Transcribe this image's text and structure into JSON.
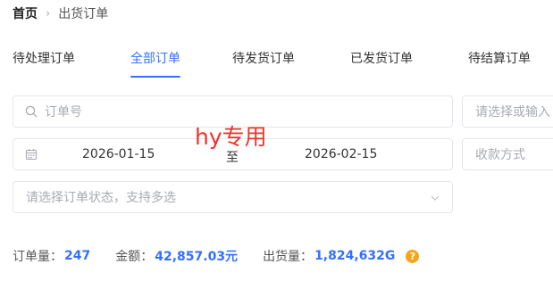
{
  "breadcrumb": {
    "home": "首页",
    "separator": "›",
    "current": "出货订单"
  },
  "tabs": [
    {
      "label": "待处理订单",
      "active": false
    },
    {
      "label": "全部订单",
      "active": true
    },
    {
      "label": "待发货订单",
      "active": false
    },
    {
      "label": "已发货订单",
      "active": false
    },
    {
      "label": "待结算订单",
      "active": false
    }
  ],
  "filters": {
    "order_no_placeholder": "订单号",
    "select_placeholder": "请选择或输入",
    "date_start": "2026-01-15",
    "date_separator": "至",
    "date_end": "2026-02-15",
    "payment_placeholder": "收款方式",
    "status_placeholder": "请选择订单状态，支持多选"
  },
  "watermark": "hy专用",
  "summary": {
    "order_count_label": "订单量：",
    "order_count": "247",
    "amount_label": "金额：",
    "amount": "42,857.03元",
    "shipment_label": "出货量：",
    "shipment": "1,824,632G",
    "help_icon_text": "?"
  },
  "colors": {
    "accent": "#3370ff",
    "watermark": "#e8362c",
    "help_badge": "#f7a41d",
    "border": "#e3e6ec",
    "placeholder": "#a8abb2"
  },
  "icons": {
    "search": "search-icon",
    "calendar": "calendar-icon",
    "dropdown": "chevron-down-icon",
    "help": "question-icon"
  }
}
